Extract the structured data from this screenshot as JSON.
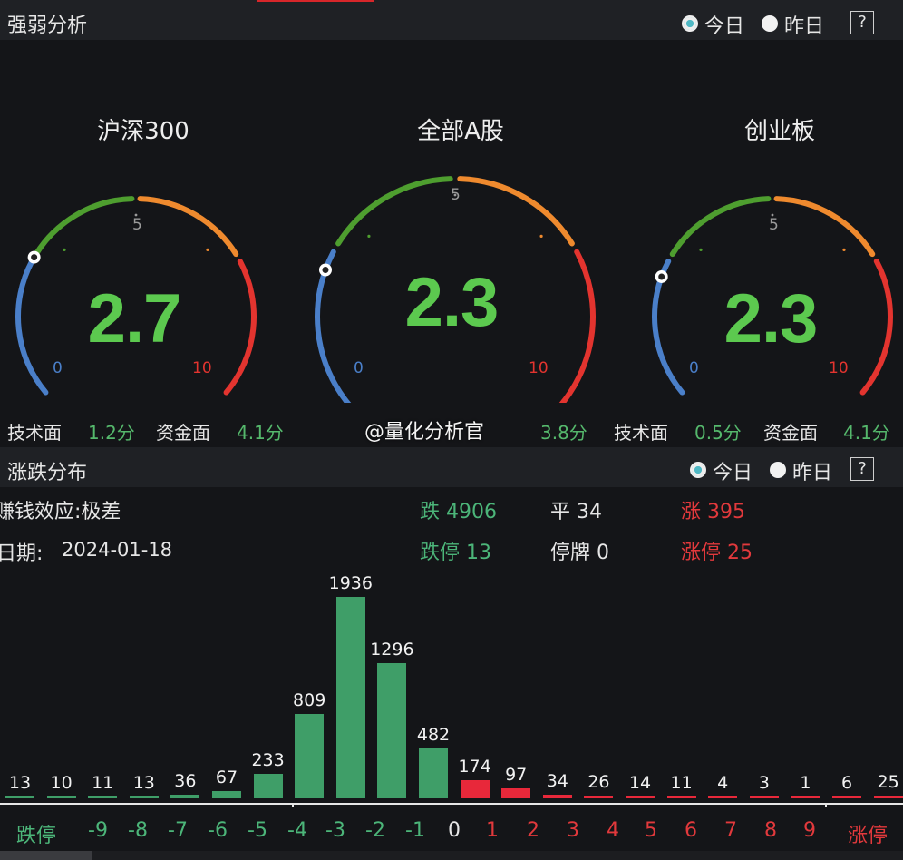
{
  "strength": {
    "title": "强弱分析",
    "today": "今日",
    "yesterday": "昨日",
    "help": "?",
    "gauges": [
      {
        "name": "沪深300",
        "value": "2.7",
        "level": 2.7,
        "min": "0",
        "mid": "5",
        "max": "10",
        "tech_label": "技术面",
        "tech": "1.2分",
        "fund_label": "资金面",
        "fund": "4.1分"
      },
      {
        "name": "全部A股",
        "value": "2.3",
        "level": 2.3,
        "min": "0",
        "mid": "5",
        "max": "10",
        "tech_label": "",
        "tech": "",
        "fund_label": "",
        "fund": "3.8分"
      },
      {
        "name": "创业板",
        "value": "2.3",
        "level": 2.3,
        "min": "0",
        "mid": "5",
        "max": "10",
        "tech_label": "技术面",
        "tech": "0.5分",
        "fund_label": "资金面",
        "fund": "4.1分"
      }
    ],
    "colors": {
      "blue": "#4a7fc9",
      "green": "#4e9e2f",
      "orange": "#ef8a2e",
      "red": "#e3342f"
    }
  },
  "watermark": "@量化分析官",
  "dist": {
    "title": "涨跌分布",
    "today": "今日",
    "yesterday": "昨日",
    "help": "?",
    "effect": "赚钱效应:极差",
    "date_label": "日期:",
    "date": "2024-01-18",
    "down": "跌 4906",
    "flat": "平 34",
    "up": "涨 395",
    "limit_down": "跌停 13",
    "suspended": "停牌 0",
    "limit_up": "涨停 25"
  },
  "chart_data": {
    "type": "bar",
    "categories": [
      "跌停",
      "-9",
      "-8",
      "-7",
      "-6",
      "-5",
      "-4",
      "-3",
      "-2",
      "-1",
      "0",
      "1",
      "2",
      "3",
      "4",
      "5",
      "6",
      "7",
      "8",
      "9",
      "涨停"
    ],
    "values": [
      13,
      10,
      11,
      13,
      36,
      67,
      233,
      809,
      1936,
      1296,
      482,
      174,
      97,
      34,
      26,
      14,
      11,
      4,
      3,
      1,
      6,
      25
    ],
    "bar_values": [
      13,
      10,
      11,
      13,
      36,
      67,
      233,
      809,
      1936,
      1296,
      482,
      174,
      97,
      34,
      26,
      14,
      11,
      4,
      3,
      1,
      6,
      25
    ],
    "bar_colors": [
      "g",
      "g",
      "g",
      "g",
      "g",
      "g",
      "g",
      "g",
      "g",
      "g",
      "g",
      "r",
      "r",
      "r",
      "r",
      "r",
      "r",
      "r",
      "r",
      "r",
      "r",
      "r"
    ],
    "ylim": [
      0,
      1936
    ]
  }
}
